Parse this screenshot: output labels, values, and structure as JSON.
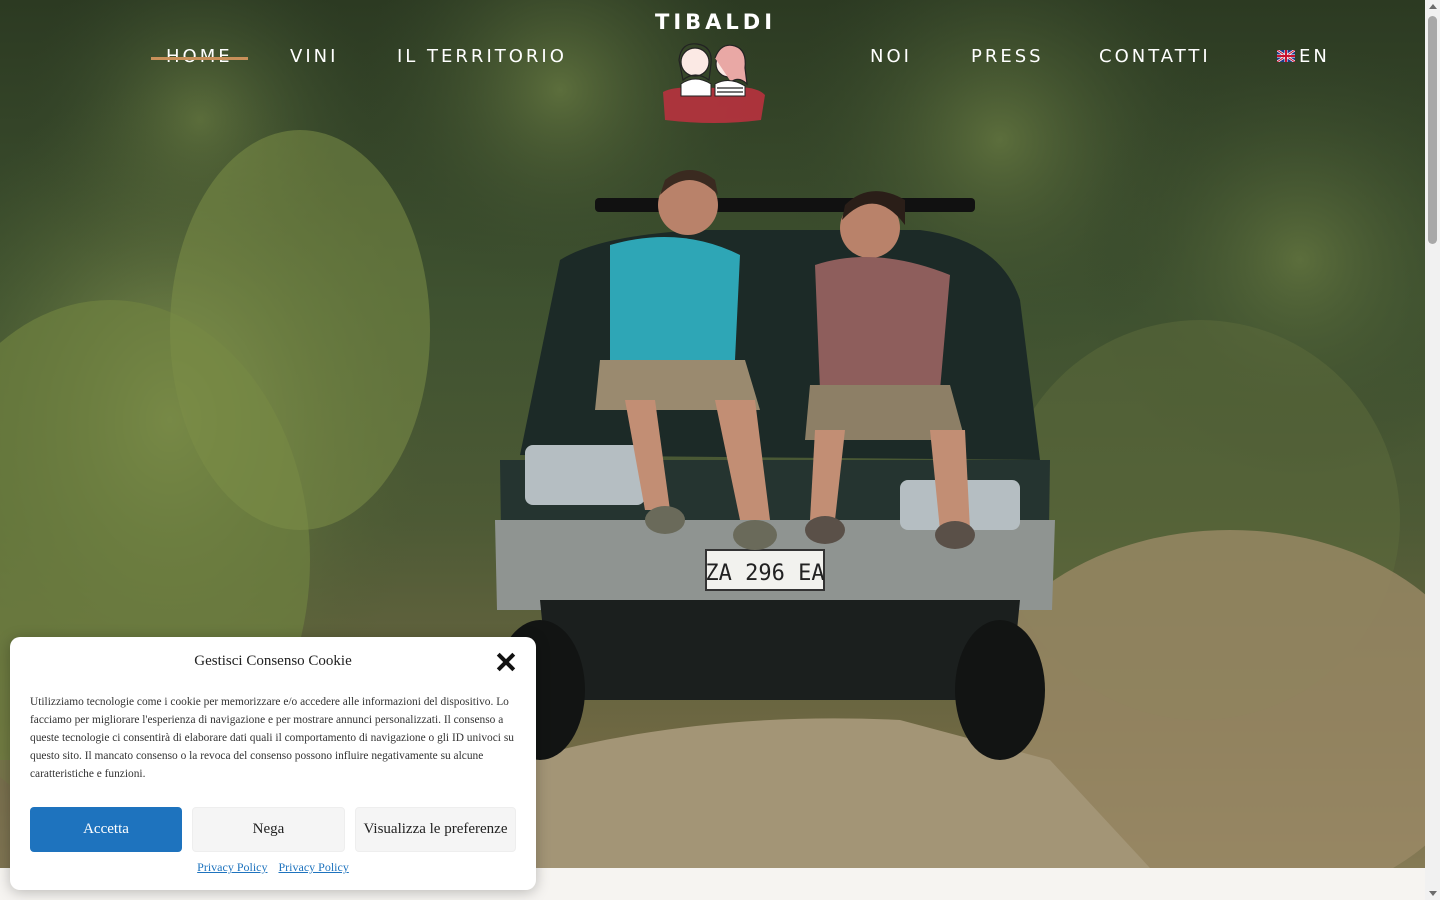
{
  "nav": {
    "items": [
      {
        "label": "HOME",
        "active": true
      },
      {
        "label": "VINI"
      },
      {
        "label": "IL TERRITORIO"
      },
      {
        "label": "NOI"
      },
      {
        "label": "PRESS"
      },
      {
        "label": "CONTATTI"
      }
    ],
    "language": {
      "label": "EN",
      "icon": "uk-flag-icon"
    },
    "accent_color": "#c8905a"
  },
  "logo": {
    "text": "TIBALDI",
    "icon": "two-women-illustration"
  },
  "hero": {
    "license_plate": "ZA 296 EA"
  },
  "cookie": {
    "title": "Gestisci Consenso Cookie",
    "body": "Utilizziamo tecnologie come i cookie per memorizzare e/o accedere alle informazioni del dispositivo. Lo facciamo per migliorare l'esperienza di navigazione e per mostrare annunci personalizzati. Il consenso a queste tecnologie ci consentirà di elaborare dati quali il comportamento di navigazione o gli ID univoci su questo sito. Il mancato consenso o la revoca del consenso possono influire negativamente su alcune caratteristiche e funzioni.",
    "accept_label": "Accetta",
    "deny_label": "Nega",
    "prefs_label": "Visualizza le preferenze",
    "links": [
      "Privacy Policy",
      "Privacy Policy"
    ],
    "accept_color": "#1e73be"
  }
}
